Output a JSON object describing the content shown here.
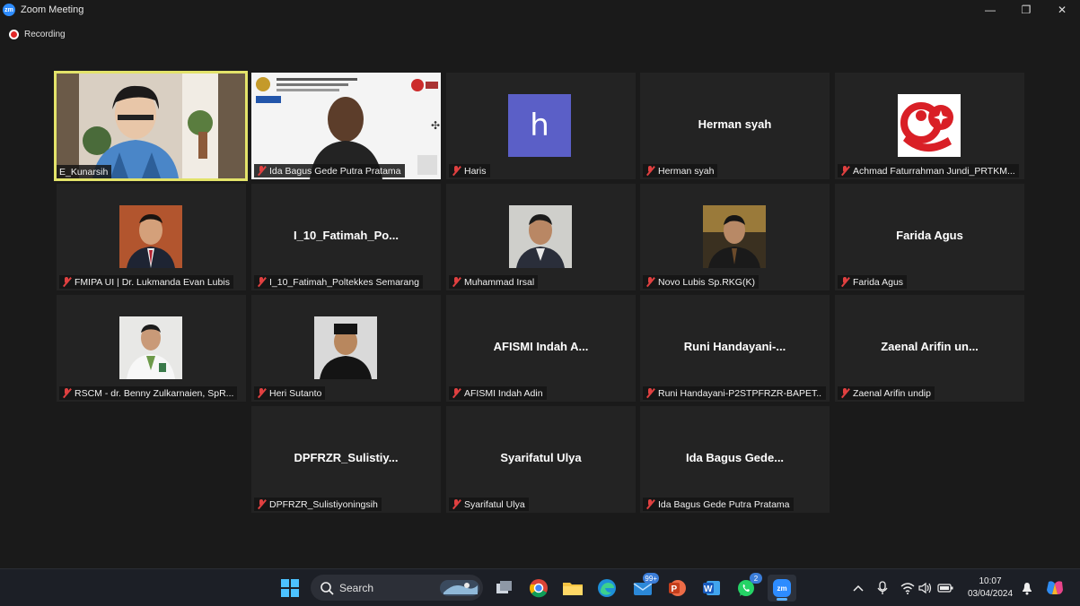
{
  "window": {
    "app_icon_text": "zm",
    "title": "Zoom Meeting",
    "minimize": "—",
    "restore": "❐",
    "close": "✕"
  },
  "recording": {
    "label": "Recording"
  },
  "participants": [
    {
      "name": "E_Kunarsih",
      "display": "",
      "type": "video",
      "active": true,
      "muted": false
    },
    {
      "name": "Ida Bagus Gede Putra Pratama",
      "display": "",
      "type": "video-slide",
      "active": false,
      "muted": true
    },
    {
      "name": "Haris",
      "display": "h",
      "type": "avatar",
      "active": false,
      "muted": true
    },
    {
      "name": "Herman syah",
      "display": "Herman syah",
      "type": "name",
      "active": false,
      "muted": true
    },
    {
      "name": "Achmad Faturrahman Jundi_PRTKM...",
      "display": "",
      "type": "logo",
      "active": false,
      "muted": true
    },
    {
      "name": "FMIPA UI | Dr. Lukmanda Evan Lubis",
      "display": "",
      "type": "photo",
      "active": false,
      "muted": true
    },
    {
      "name": "I_10_Fatimah_Poltekkes Semarang",
      "display": "I_10_Fatimah_Po...",
      "type": "name",
      "active": false,
      "muted": true
    },
    {
      "name": "Muhammad Irsal",
      "display": "",
      "type": "photo",
      "active": false,
      "muted": true
    },
    {
      "name": "Novo Lubis Sp.RKG(K)",
      "display": "",
      "type": "photo",
      "active": false,
      "muted": true
    },
    {
      "name": "Farida Agus",
      "display": "Farida Agus",
      "type": "name",
      "active": false,
      "muted": true
    },
    {
      "name": "RSCM - dr. Benny Zulkarnaien, SpR...",
      "display": "",
      "type": "photo",
      "active": false,
      "muted": true
    },
    {
      "name": "Heri Sutanto",
      "display": "",
      "type": "photo",
      "active": false,
      "muted": true
    },
    {
      "name": "AFISMI Indah Adin",
      "display": "AFISMI Indah A...",
      "type": "name",
      "active": false,
      "muted": true
    },
    {
      "name": "Runi Handayani-P2STPFRZR-BAPET...",
      "display": "Runi Handayani-...",
      "type": "name",
      "active": false,
      "muted": true
    },
    {
      "name": "Zaenal Arifin undip",
      "display": "Zaenal Arifin un...",
      "type": "name",
      "active": false,
      "muted": true
    },
    {
      "name": "DPFRZR_Sulistiyoningsih",
      "display": "DPFRZR_Sulistiy...",
      "type": "name",
      "active": false,
      "muted": true
    },
    {
      "name": "Syarifatul Ulya",
      "display": "Syarifatul Ulya",
      "type": "name",
      "active": false,
      "muted": true
    },
    {
      "name": "Ida Bagus Gede Putra Pratama",
      "display": "Ida Bagus Gede...",
      "type": "name",
      "active": false,
      "muted": true
    }
  ],
  "taskbar": {
    "search_label": "Search",
    "mail_badge": "99+",
    "whatsapp_badge": "2",
    "zoom_label": "zm",
    "time": "10:07",
    "date": "03/04/2024"
  },
  "colors": {
    "active_border": "#e3e36a",
    "tile_bg": "#232323",
    "muted_red": "#e04040",
    "avatar_purple": "#5b5fc7"
  }
}
